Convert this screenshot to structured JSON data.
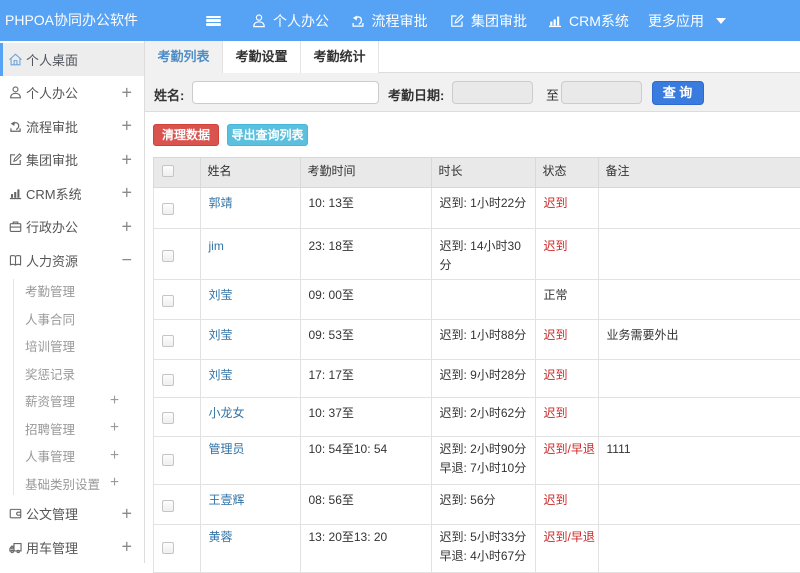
{
  "topbar": {
    "title": "PHPOA协同办公软件",
    "nav": [
      {
        "label": "个人办公",
        "icon": "user-icon"
      },
      {
        "label": "流程审批",
        "icon": "share-icon"
      },
      {
        "label": "集团审批",
        "icon": "edit-icon"
      },
      {
        "label": "CRM系统",
        "icon": "barchart-icon"
      },
      {
        "label": "更多应用",
        "icon": "",
        "caret": true
      }
    ]
  },
  "sidebar": {
    "items": [
      {
        "label": "个人桌面",
        "icon": "home-icon",
        "active": true
      },
      {
        "label": "个人办公",
        "icon": "user-icon",
        "expand": "+"
      },
      {
        "label": "流程审批",
        "icon": "share-icon",
        "expand": "+"
      },
      {
        "label": "集团审批",
        "icon": "edit-icon",
        "expand": "+"
      },
      {
        "label": "CRM系统",
        "icon": "barchart-icon",
        "expand": "+"
      },
      {
        "label": "行政办公",
        "icon": "briefcase-icon",
        "expand": "+"
      },
      {
        "label": "人力资源",
        "icon": "book-icon",
        "expand": "−",
        "children": [
          {
            "label": "考勤管理"
          },
          {
            "label": "人事合同"
          },
          {
            "label": "培训管理"
          },
          {
            "label": "奖惩记录"
          },
          {
            "label": "薪资管理",
            "expand": "+"
          },
          {
            "label": "招聘管理",
            "expand": "+"
          },
          {
            "label": "人事管理",
            "expand": "+"
          },
          {
            "label": "基础类别设置",
            "expand": "+"
          }
        ]
      },
      {
        "label": "公文管理",
        "icon": "wallet-icon",
        "expand": "+"
      },
      {
        "label": "用车管理",
        "icon": "truck-icon",
        "expand": "+"
      }
    ]
  },
  "tabs": [
    {
      "label": "考勤列表",
      "active": true
    },
    {
      "label": "考勤设置",
      "active": false
    },
    {
      "label": "考勤统计",
      "active": false
    }
  ],
  "filter": {
    "name_label": "姓名:",
    "date_label": "考勤日期:",
    "to_label": "至",
    "query_button": "查 询",
    "name_value": "",
    "date_from_value": "",
    "date_to_value": ""
  },
  "actions": {
    "clear_button": "清理数据",
    "export_button": "导出查询列表"
  },
  "table": {
    "columns": [
      "姓名",
      "考勤时间",
      "时长",
      "状态",
      "备注"
    ],
    "rows": [
      {
        "name": "郭靖",
        "time": "10: 13至",
        "duration": [
          "迟到: 1小时22分"
        ],
        "status": "迟到",
        "status_red": true,
        "note": ""
      },
      {
        "name": "jim",
        "time": "23: 18至",
        "duration": [
          "迟到: 14小时30分"
        ],
        "status": "迟到",
        "status_red": true,
        "note": "",
        "tall": true
      },
      {
        "name": "刘莹",
        "time": "09: 00至",
        "duration": [],
        "status": "正常",
        "status_red": false,
        "note": ""
      },
      {
        "name": "刘莹",
        "time": "09: 53至",
        "duration": [
          "迟到: 1小时88分"
        ],
        "status": "迟到",
        "status_red": true,
        "note": "业务需要外出"
      },
      {
        "name": "刘莹",
        "time": "17: 17至",
        "duration": [
          "迟到: 9小时28分"
        ],
        "status": "迟到",
        "status_red": true,
        "note": ""
      },
      {
        "name": "小龙女",
        "time": "10: 37至",
        "duration": [
          "迟到: 2小时62分"
        ],
        "status": "迟到",
        "status_red": true,
        "note": ""
      },
      {
        "name": "管理员",
        "time": "10: 54至10: 54",
        "duration": [
          "迟到: 2小时90分",
          "早退: 7小时10分"
        ],
        "status": "迟到/早退",
        "status_red": true,
        "note": "1111",
        "tall": true
      },
      {
        "name": "王壹辉",
        "time": "08: 56至",
        "duration": [
          "迟到: 56分"
        ],
        "status": "迟到",
        "status_red": true,
        "note": ""
      },
      {
        "name": "黄蓉",
        "time": "13: 20至13: 20",
        "duration": [
          "迟到: 5小时33分",
          "早退: 4小时67分"
        ],
        "status": "迟到/早退",
        "status_red": true,
        "note": "",
        "tall": true
      }
    ]
  },
  "colors": {
    "topbar": "#56a2f5",
    "active_tab_text": "#4f8ec5",
    "query_button": "#3a7be0",
    "danger_button": "#d9534f",
    "info_button": "#5bc0de",
    "link": "#3274a8",
    "status_red": "#cc2727"
  }
}
